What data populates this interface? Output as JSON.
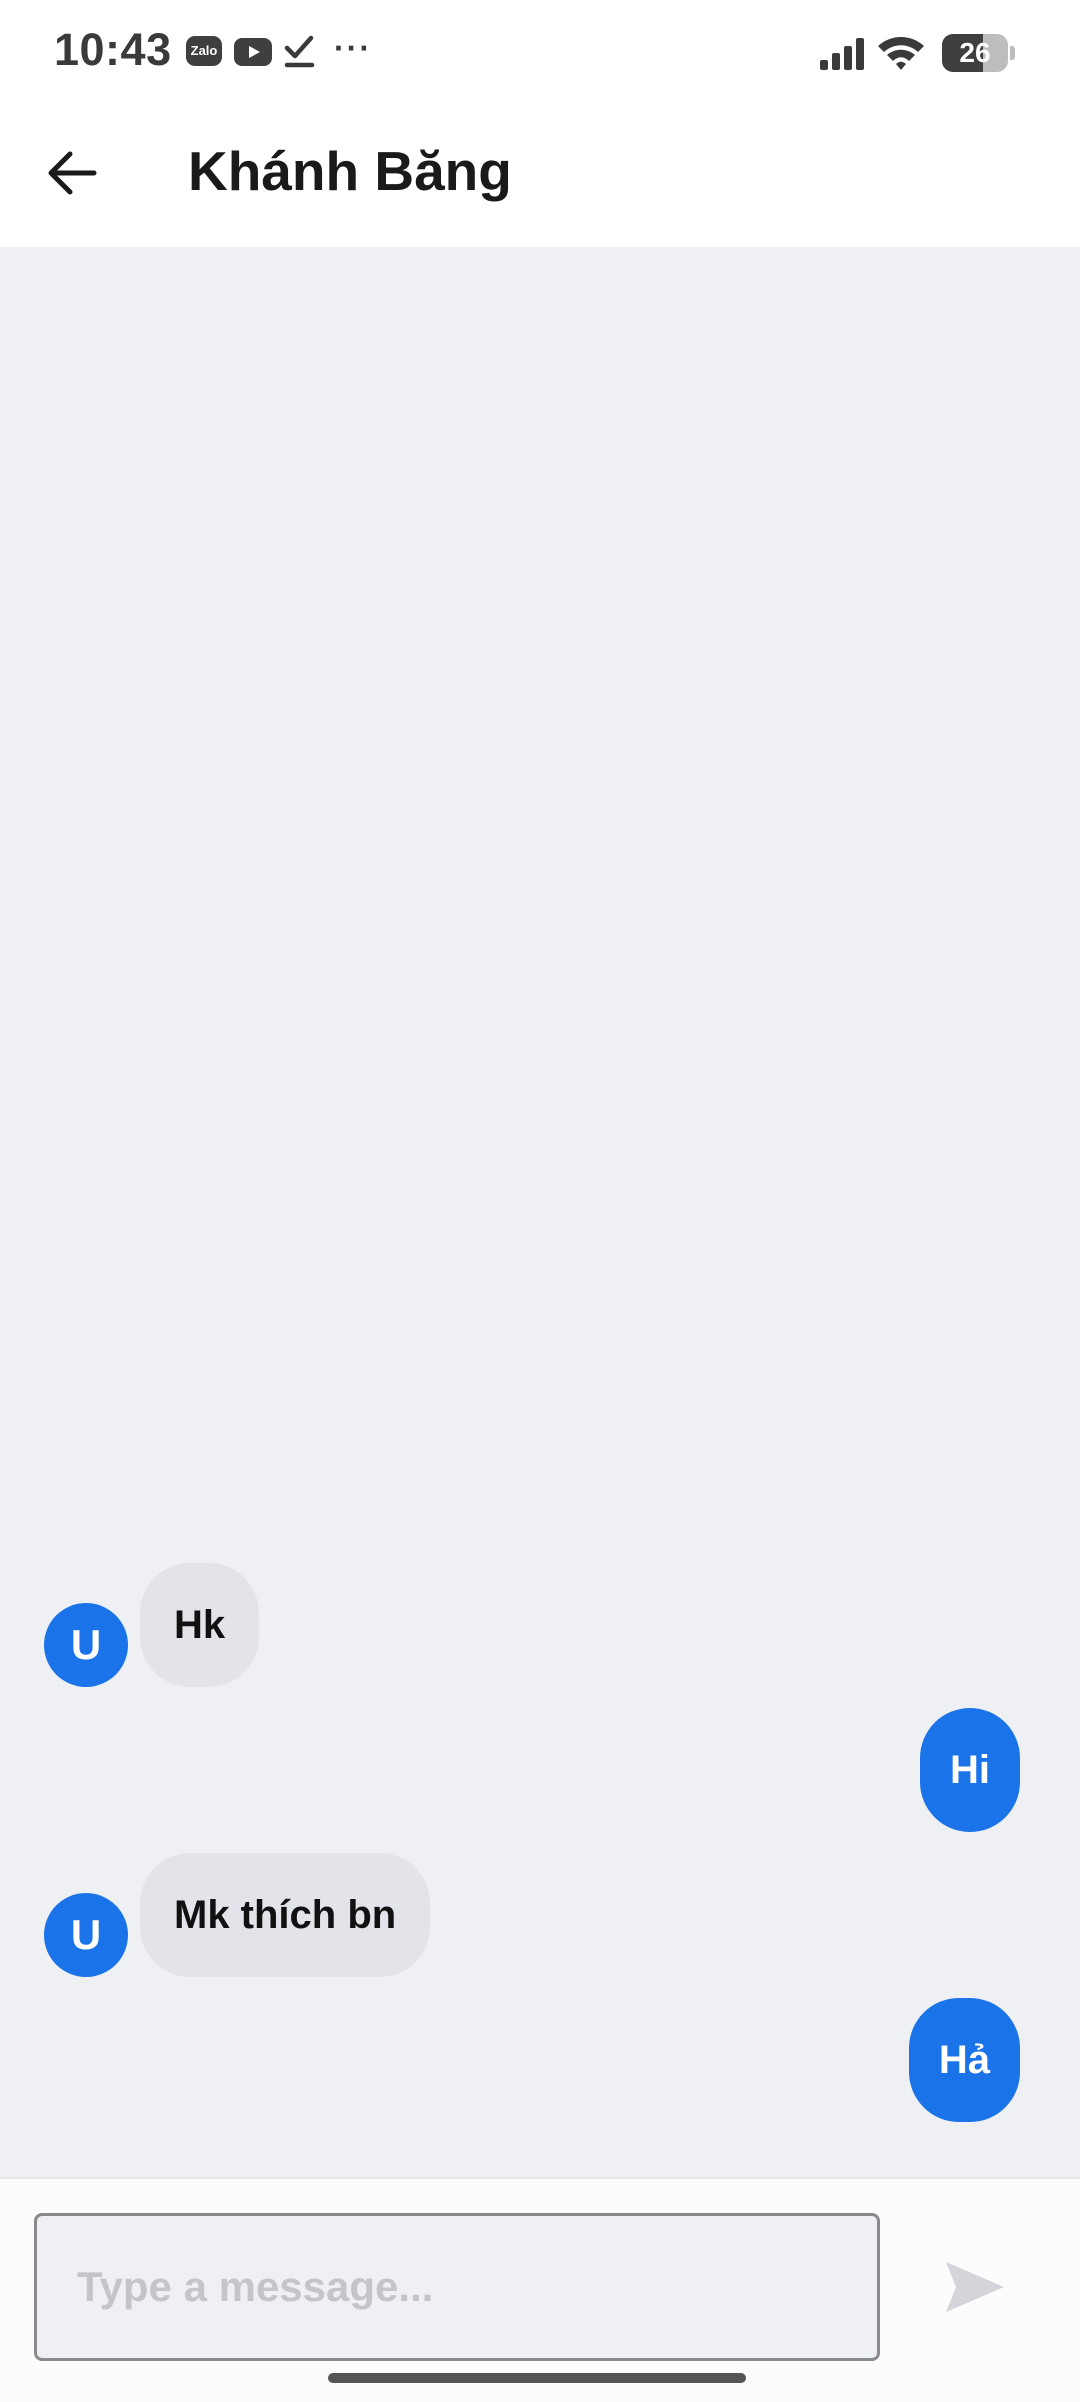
{
  "status_bar": {
    "time": "10:43",
    "notification_icons": [
      "zalo-icon",
      "youtube-icon",
      "checkmark-icon",
      "more-dots-icon"
    ],
    "zalo_label": "Zalo",
    "more_indicator": "···",
    "battery_level": 26,
    "battery_text": "26"
  },
  "header": {
    "back_icon": "arrow-left-icon",
    "contact_name": "Khánh Băng"
  },
  "messages": [
    {
      "direction": "incoming",
      "avatar": "U",
      "text": "Hk"
    },
    {
      "direction": "outgoing",
      "text": "Hi"
    },
    {
      "direction": "incoming",
      "avatar": "U",
      "text": "Mk thích bn"
    },
    {
      "direction": "outgoing",
      "text": "Hả"
    }
  ],
  "composer": {
    "placeholder": "Type a message...",
    "value": "",
    "send_icon": "send-icon"
  },
  "colors": {
    "accent": "#1a73e8",
    "chat_background": "#eff0f4",
    "incoming_bubble": "#e3e4e9"
  }
}
